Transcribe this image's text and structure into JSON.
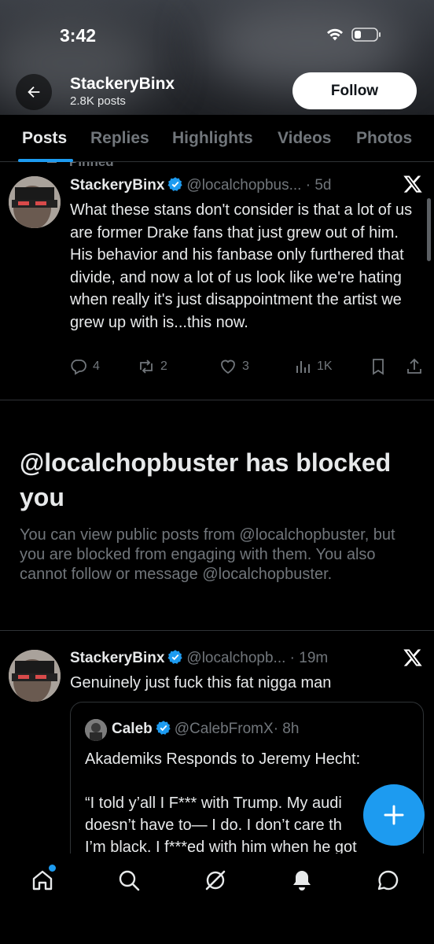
{
  "status_bar": {
    "time": "3:42"
  },
  "profile": {
    "name": "StackeryBinx",
    "posts_count": "2.8K posts",
    "follow_label": "Follow"
  },
  "tabs": [
    {
      "label": "Posts",
      "active": true
    },
    {
      "label": "Replies",
      "active": false
    },
    {
      "label": "Highlights",
      "active": false
    },
    {
      "label": "Videos",
      "active": false
    },
    {
      "label": "Photos",
      "active": false
    }
  ],
  "pinned_label": "Pinned",
  "tweet1": {
    "name": "StackeryBinx",
    "handle": "@localchopbus...",
    "time": "· 5d",
    "text": "What these stans don't consider is that a lot of us are former Drake fans that just grew out of him. His behavior and his fanbase only furthered that divide, and now a lot of us look like we're hating when really it's just disappointment the artist we grew up with is...this now.",
    "replies": "4",
    "reposts": "2",
    "likes": "3",
    "views": "1K"
  },
  "blocked": {
    "title": "@localchopbuster has blocked you",
    "text": "You can view public posts from @localchopbuster, but you are blocked from engaging with them. You also cannot follow or message @localchopbuster."
  },
  "tweet2": {
    "name": "StackeryBinx",
    "handle": "@localchopb...",
    "time": "· 19m",
    "text": "Genuinely just fuck this fat nigga man"
  },
  "quote": {
    "name": "Caleb",
    "handle": "@CalebFromX",
    "time": "· 8h",
    "text": "Akademiks Responds to Jeremy Hecht:\n\n“I told y’all I F*** with Trump. My audi\ndoesn’t have to— I do. I don’t care th\nI’m black. I f***ed with him when he got"
  },
  "colors": {
    "accent": "#1d9bf0",
    "muted": "#71767b",
    "background": "#000000"
  },
  "icons": {
    "nav": [
      "home-icon",
      "search-icon",
      "grok-icon",
      "notifications-icon",
      "messages-icon"
    ]
  }
}
